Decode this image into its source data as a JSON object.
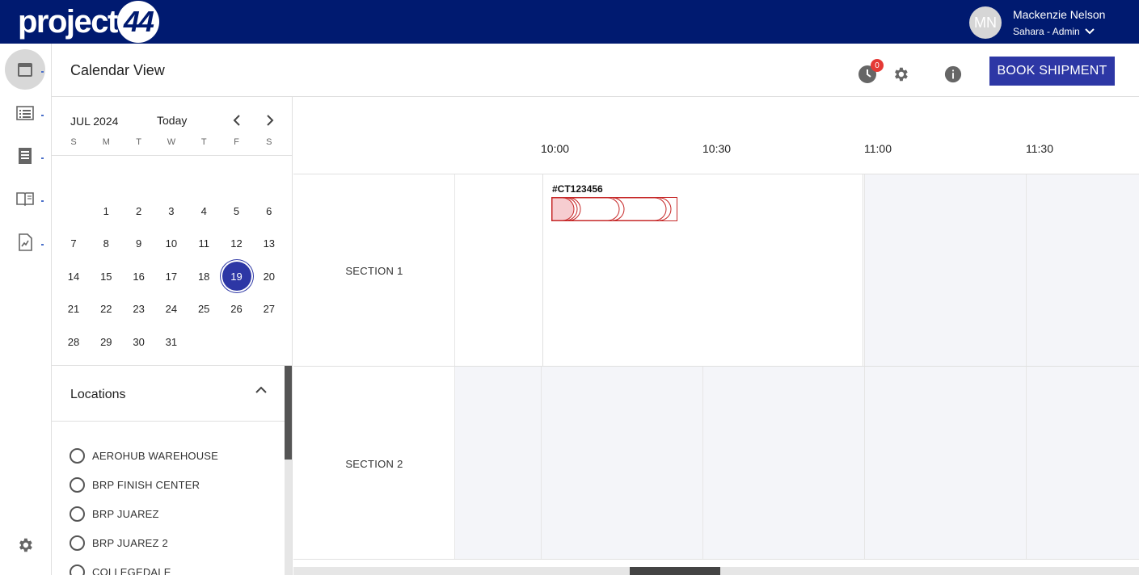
{
  "brand": {
    "logo_text": "project",
    "logo_badge": "44"
  },
  "user": {
    "initials": "MN",
    "name": "Mackenzie Nelson",
    "role": "Sahara - Admin"
  },
  "nav": {
    "items": [
      "calendar-icon",
      "list-icon",
      "document-list-icon",
      "book-icon",
      "report-icon"
    ],
    "bottom": "gear-icon"
  },
  "header": {
    "title": "Calendar View",
    "notification_count": "0",
    "book_button": "BOOK SHIPMENT"
  },
  "calendar": {
    "month": "JUL 2024",
    "today": "Today",
    "weekdays": [
      "S",
      "M",
      "T",
      "W",
      "T",
      "F",
      "S"
    ],
    "weeks": [
      [
        "",
        "1",
        "2",
        "3",
        "4",
        "5",
        "6"
      ],
      [
        "7",
        "8",
        "9",
        "10",
        "11",
        "12",
        "13"
      ],
      [
        "14",
        "15",
        "16",
        "17",
        "18",
        "19",
        "20"
      ],
      [
        "21",
        "22",
        "23",
        "24",
        "25",
        "26",
        "27"
      ],
      [
        "28",
        "29",
        "30",
        "31",
        "",
        "",
        ""
      ]
    ],
    "selected_day": "19"
  },
  "locations": {
    "title": "Locations",
    "items": [
      "AEROHUB WAREHOUSE",
      "BRP FINISH CENTER",
      "BRP JUAREZ",
      "BRP JUAREZ 2",
      "COLLEGEDALE"
    ]
  },
  "timeline": {
    "times": [
      "10:00",
      "10:30",
      "11:00",
      "11:30"
    ],
    "sections": [
      "SECTION 1",
      "SECTION 2"
    ],
    "booking": {
      "id": "#CT123456"
    }
  },
  "colors": {
    "topbar": "#001a70",
    "primary": "#2d37a5",
    "badge": "#e53935",
    "booking_stroke": "#c62828",
    "free_slot": "#f4f5f9"
  }
}
